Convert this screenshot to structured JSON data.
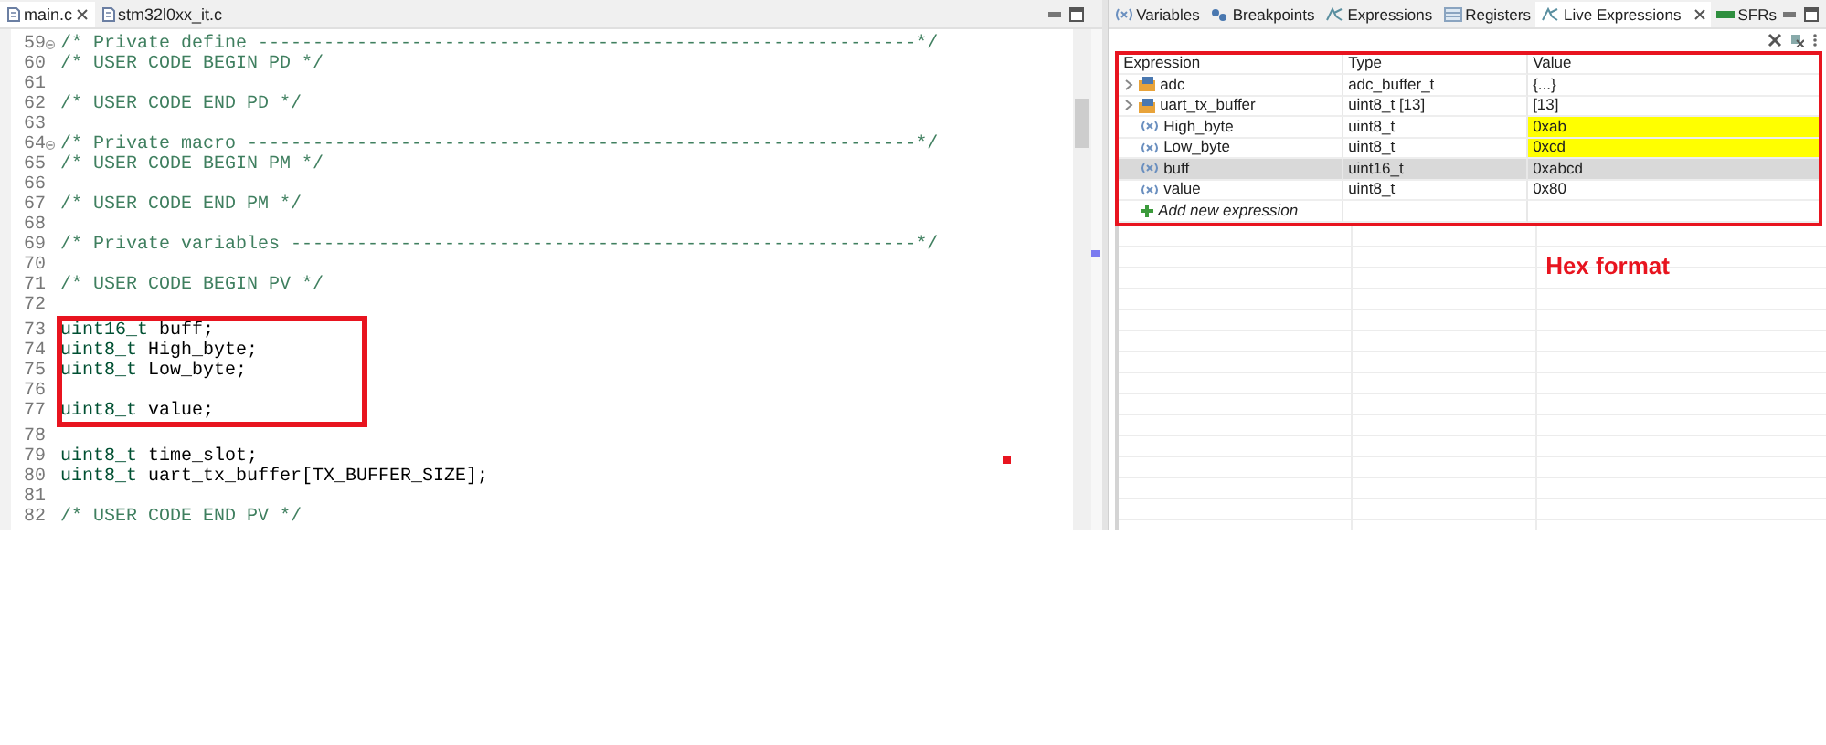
{
  "editor": {
    "tabs": [
      {
        "label": "main.c",
        "selected": true,
        "closable": true
      },
      {
        "label": "stm32l0xx_it.c",
        "selected": false,
        "closable": false
      }
    ],
    "lines": [
      {
        "number": "59",
        "fold_marker": true,
        "boxed": false,
        "segments": [
          {
            "kind": "comment",
            "text": "/* Private define ------------------------------------------------------------*/"
          }
        ]
      },
      {
        "number": "60",
        "fold_marker": false,
        "boxed": false,
        "segments": [
          {
            "kind": "comment",
            "text": "/* USER CODE BEGIN PD */"
          }
        ]
      },
      {
        "number": "61",
        "fold_marker": false,
        "boxed": false
      },
      {
        "number": "62",
        "fold_marker": false,
        "boxed": false,
        "segments": [
          {
            "kind": "comment",
            "text": "/* USER CODE END PD */"
          }
        ]
      },
      {
        "number": "63",
        "fold_marker": false,
        "boxed": false
      },
      {
        "number": "64",
        "fold_marker": true,
        "boxed": false,
        "segments": [
          {
            "kind": "comment",
            "text": "/* Private macro -------------------------------------------------------------*/"
          }
        ]
      },
      {
        "number": "65",
        "fold_marker": false,
        "boxed": false,
        "segments": [
          {
            "kind": "comment",
            "text": "/* USER CODE BEGIN PM */"
          }
        ]
      },
      {
        "number": "66",
        "fold_marker": false,
        "boxed": false
      },
      {
        "number": "67",
        "fold_marker": false,
        "boxed": false,
        "segments": [
          {
            "kind": "comment",
            "text": "/* USER CODE END PM */"
          }
        ]
      },
      {
        "number": "68",
        "fold_marker": false,
        "boxed": false
      },
      {
        "number": "69",
        "fold_marker": false,
        "boxed": false,
        "segments": [
          {
            "kind": "comment",
            "text": "/* Private variables ---------------------------------------------------------*/"
          }
        ]
      },
      {
        "number": "70",
        "fold_marker": false,
        "boxed": false
      },
      {
        "number": "71",
        "fold_marker": false,
        "boxed": false,
        "segments": [
          {
            "kind": "comment",
            "text": "/* USER CODE BEGIN PV */"
          }
        ]
      },
      {
        "number": "72",
        "fold_marker": false,
        "boxed": false
      },
      {
        "number": "73",
        "fold_marker": false,
        "boxed": true,
        "segments": [
          {
            "kind": "type",
            "text": "uint16_t"
          },
          {
            "kind": "plain",
            "text": " buff;"
          }
        ]
      },
      {
        "number": "74",
        "fold_marker": false,
        "boxed": true,
        "segments": [
          {
            "kind": "type",
            "text": "uint8_t"
          },
          {
            "kind": "plain",
            "text": " High_byte;"
          }
        ]
      },
      {
        "number": "75",
        "fold_marker": false,
        "boxed": true,
        "segments": [
          {
            "kind": "type",
            "text": "uint8_t"
          },
          {
            "kind": "plain",
            "text": " Low_byte;"
          }
        ]
      },
      {
        "number": "76",
        "fold_marker": false,
        "boxed": true
      },
      {
        "number": "77",
        "fold_marker": false,
        "boxed": true,
        "segments": [
          {
            "kind": "type",
            "text": "uint8_t"
          },
          {
            "kind": "plain",
            "text": " value;"
          }
        ]
      },
      {
        "number": "78",
        "fold_marker": false,
        "boxed": false
      },
      {
        "number": "79",
        "fold_marker": false,
        "boxed": false,
        "segments": [
          {
            "kind": "type",
            "text": "uint8_t"
          },
          {
            "kind": "plain",
            "text": " time_slot;"
          }
        ]
      },
      {
        "number": "80",
        "fold_marker": false,
        "boxed": false,
        "segments": [
          {
            "kind": "type",
            "text": "uint8_t"
          },
          {
            "kind": "plain",
            "text": " uart_tx_buffer[TX_BUFFER_SIZE];"
          }
        ]
      },
      {
        "number": "81",
        "fold_marker": false,
        "boxed": false
      },
      {
        "number": "82",
        "fold_marker": false,
        "boxed": false,
        "segments": [
          {
            "kind": "comment",
            "text": "/* USER CODE END PV */"
          }
        ]
      }
    ],
    "marks": [
      {
        "kind": "dot"
      }
    ]
  },
  "debug_panel": {
    "tabs": [
      {
        "label": "Variables",
        "selected": false,
        "closable": false
      },
      {
        "label": "Breakpoints",
        "selected": false,
        "closable": false
      },
      {
        "label": "Expressions",
        "selected": false,
        "closable": false
      },
      {
        "label": "Registers",
        "selected": false,
        "closable": false
      },
      {
        "label": "Live Expressions",
        "selected": true,
        "closable": true
      },
      {
        "label": "SFRs",
        "selected": false,
        "closable": false
      }
    ],
    "table": {
      "annotated": true,
      "columns": [
        "Expression",
        "Type",
        "Value"
      ],
      "rows": [
        {
          "kind": "struct",
          "expression": "adc",
          "type": "adc_buffer_t",
          "value": "{...}",
          "expanded": false,
          "selected": false,
          "changed": false
        },
        {
          "kind": "struct",
          "expression": "uart_tx_buffer",
          "type": "uint8_t [13]",
          "value": "[13]",
          "expanded": false,
          "selected": false,
          "changed": false
        },
        {
          "kind": "variable",
          "expression": "High_byte",
          "type": "uint8_t",
          "value": "0xab",
          "selected": false,
          "changed": true
        },
        {
          "kind": "variable",
          "expression": "Low_byte",
          "type": "uint8_t",
          "value": "0xcd",
          "selected": false,
          "changed": true
        },
        {
          "kind": "variable",
          "expression": "buff",
          "type": "uint16_t",
          "value": "0xabcd",
          "selected": true,
          "changed": false
        },
        {
          "kind": "variable",
          "expression": "value",
          "type": "uint8_t",
          "value": "0x80",
          "selected": false,
          "changed": false
        },
        {
          "kind": "add",
          "expression": "Add new expression"
        }
      ]
    },
    "annotation": "Hex format"
  }
}
